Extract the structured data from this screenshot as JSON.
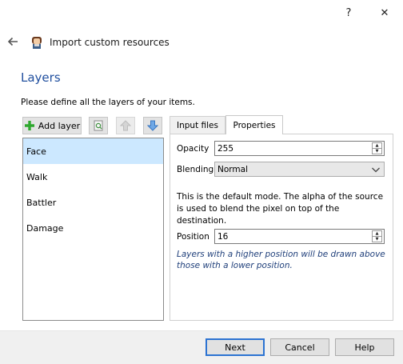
{
  "window": {
    "help_glyph": "?",
    "close_glyph": "✕",
    "back_glyph": "←"
  },
  "wizard": {
    "title": "Import custom resources"
  },
  "section": {
    "title": "Layers",
    "description": "Please define all the layers of your items."
  },
  "toolbar": {
    "add_layer_label": "Add layer"
  },
  "layers": {
    "items": [
      "Face",
      "Walk",
      "Battler",
      "Damage"
    ],
    "selected_index": 0
  },
  "tabs": {
    "input_files": "Input files",
    "properties": "Properties",
    "active": "Properties"
  },
  "properties": {
    "opacity_label": "Opacity",
    "opacity_value": "255",
    "blending_label": "Blending",
    "blending_value": "Normal",
    "blending_description": "This is the default mode. The alpha of the source is used to blend the pixel on top of the destination.",
    "position_label": "Position",
    "position_value": "16",
    "position_note": "Layers with a higher position will be drawn above those with a lower position."
  },
  "footer": {
    "next_label": "Next",
    "cancel_label": "Cancel",
    "help_label": "Help"
  },
  "colors": {
    "section_title": "#1f4e9e",
    "selected_row": "#cce8ff",
    "primary_border": "#2c73d2",
    "add_icon": "#2ea82e",
    "arrow_icon": "#4a90d9"
  }
}
